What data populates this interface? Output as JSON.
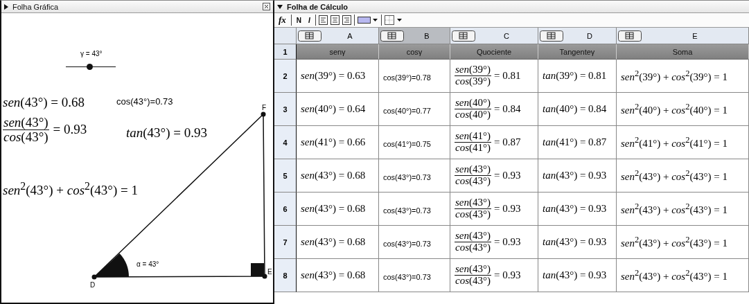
{
  "graphics": {
    "title": "Folha Gráfica",
    "slider": {
      "label": "γ = 43°",
      "level": 0.47
    },
    "formulas": [
      {
        "kind": "math",
        "text": "*sen*(43°) = 0.68"
      },
      {
        "kind": "plain",
        "text": "cos(43°)=0.73"
      },
      {
        "kind": "fraction",
        "num": "*sen*(43°)",
        "den": "*cos*(43°)",
        "result": "= 0.93"
      },
      {
        "kind": "math",
        "text": "*tan*(43°) = 0.93"
      },
      {
        "kind": "math",
        "text": "*sen*$^{2}$(43°) + *cos*$^{2}$(43°) = 1"
      }
    ],
    "points": [
      "D",
      "E",
      "F"
    ],
    "angle_label": "α = 43°"
  },
  "spreadsheet": {
    "title": "Folha de Cálculo",
    "toolbar": {
      "formula": "fx",
      "bold": "N",
      "italic": "I"
    },
    "columns": [
      {
        "label": "A",
        "selected": false
      },
      {
        "label": "B",
        "selected": true
      },
      {
        "label": "C",
        "selected": false
      },
      {
        "label": "D",
        "selected": false
      },
      {
        "label": "E",
        "selected": false
      }
    ],
    "rows": [
      {
        "kind": "header",
        "number": "1",
        "cells": [
          "senγ",
          "cosγ",
          "Quociente",
          "Tangenteγ",
          "Soma"
        ]
      },
      {
        "kind": "data",
        "number": "2",
        "sen": "*sen*(39°) = 0.63",
        "cos": "cos(39°)=0.78",
        "quotient": {
          "num": "*sen*(39°)",
          "den": "*cos*(39°)",
          "result": "= 0.81"
        },
        "tan": "*tan*(39°) = 0.81",
        "sum": "*sen*$^{2}$(39°) + *cos*$^{2}$(39°) = 1"
      },
      {
        "kind": "data",
        "number": "3",
        "sen": "*sen*(40°) = 0.64",
        "cos": "cos(40°)=0.77",
        "quotient": {
          "num": "*sen*(40°)",
          "den": "*cos*(40°)",
          "result": "= 0.84"
        },
        "tan": "*tan*(40°) = 0.84",
        "sum": "*sen*$^{2}$(40°) + *cos*$^{2}$(40°) = 1"
      },
      {
        "kind": "data",
        "number": "4",
        "sen": "*sen*(41°) = 0.66",
        "cos": "cos(41°)=0.75",
        "quotient": {
          "num": "*sen*(41°)",
          "den": "*cos*(41°)",
          "result": "= 0.87"
        },
        "tan": "*tan*(41°) = 0.87",
        "sum": "*sen*$^{2}$(41°) + *cos*$^{2}$(41°) = 1"
      },
      {
        "kind": "data",
        "number": "5",
        "sen": "*sen*(43°) = 0.68",
        "cos": "cos(43°)=0.73",
        "quotient": {
          "num": "*sen*(43°)",
          "den": "*cos*(43°)",
          "result": "= 0.93"
        },
        "tan": "*tan*(43°) = 0.93",
        "sum": "*sen*$^{2}$(43°) + *cos*$^{2}$(43°) = 1"
      },
      {
        "kind": "data",
        "number": "6",
        "sen": "*sen*(43°) = 0.68",
        "cos": "cos(43°)=0.73",
        "quotient": {
          "num": "*sen*(43°)",
          "den": "*cos*(43°)",
          "result": "= 0.93"
        },
        "tan": "*tan*(43°) = 0.93",
        "sum": "*sen*$^{2}$(43°) + *cos*$^{2}$(43°) = 1"
      },
      {
        "kind": "data",
        "number": "7",
        "sen": "*sen*(43°) = 0.68",
        "cos": "cos(43°)=0.73",
        "quotient": {
          "num": "*sen*(43°)",
          "den": "*cos*(43°)",
          "result": "= 0.93"
        },
        "tan": "*tan*(43°) = 0.93",
        "sum": "*sen*$^{2}$(43°) + *cos*$^{2}$(43°) = 1"
      },
      {
        "kind": "data",
        "number": "8",
        "sen": "*sen*(43°) = 0.68",
        "cos": "cos(43°)=0.73",
        "quotient": {
          "num": "*sen*(43°)",
          "den": "*cos*(43°)",
          "result": "= 0.93"
        },
        "tan": "*tan*(43°) = 0.93",
        "sum": "*sen*$^{2}$(43°) + *cos*$^{2}$(43°) = 1"
      }
    ]
  }
}
